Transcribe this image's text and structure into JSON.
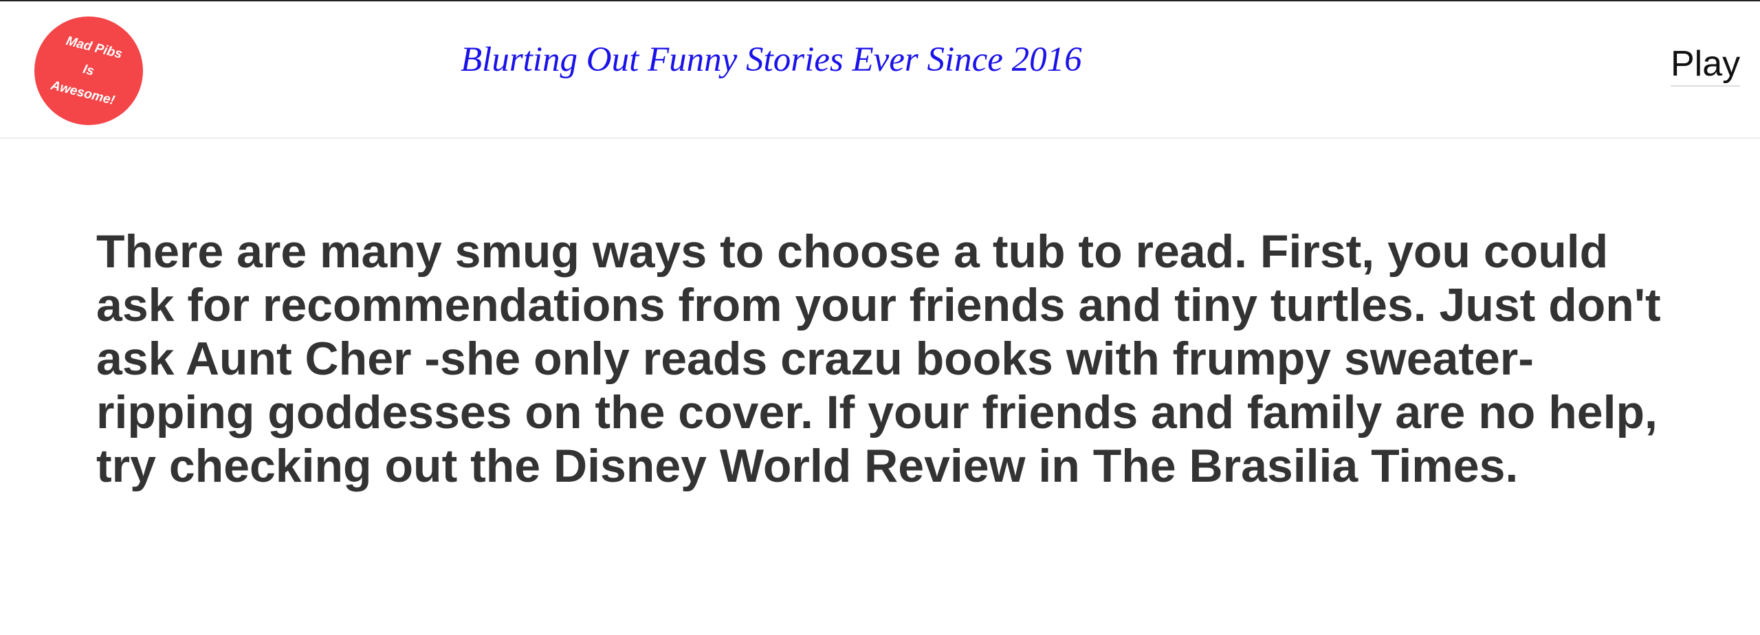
{
  "header": {
    "logo": {
      "lines": [
        "Mad Pibs",
        "Is",
        "Awesome!"
      ],
      "color": "#f44548"
    },
    "tagline": "Blurting Out Funny Stories Ever Since 2016",
    "tagline_color": "#1a12e8",
    "play_label": "Play"
  },
  "main": {
    "story": "There are many smug ways to choose a tub to read. First, you could ask for recommendations from your friends and tiny turtles. Just don't ask Aunt Cher -she only reads crazu books with frumpy sweater-ripping goddesses on the cover. If your friends and family are no help, try checking out the Disney World Review in The Brasilia Times."
  }
}
